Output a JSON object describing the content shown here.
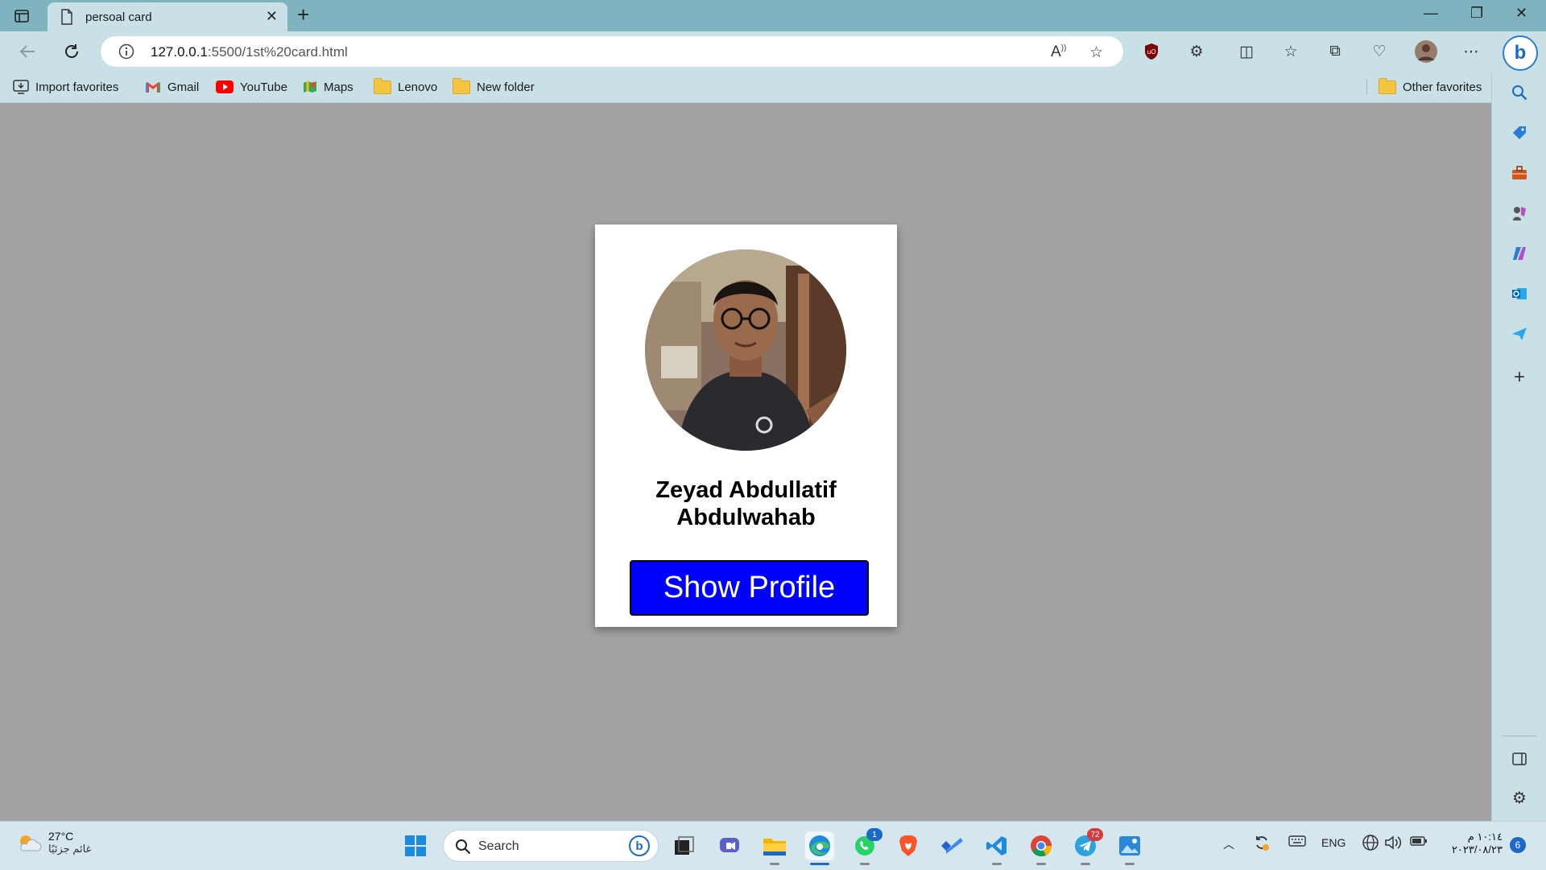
{
  "tab": {
    "title": "persoal card"
  },
  "address": {
    "host": "127.0.0.1",
    "path": ":5500/1st%20card.html"
  },
  "favorites": {
    "items": [
      {
        "label": "Import favorites",
        "icon": "import-icon"
      },
      {
        "label": "Gmail",
        "icon": "gmail-icon"
      },
      {
        "label": "YouTube",
        "icon": "youtube-icon"
      },
      {
        "label": "Maps",
        "icon": "maps-icon"
      },
      {
        "label": "Lenovo",
        "icon": "folder-icon"
      },
      {
        "label": "New folder",
        "icon": "folder-icon"
      }
    ],
    "other": "Other favorites"
  },
  "card": {
    "name_line1": "Zeyad Abdullatif",
    "name_line2": "Abdulwahab",
    "button_label": "Show Profile",
    "button_color": "#0000ff"
  },
  "taskbar": {
    "weather_temp": "27°C",
    "weather_desc": "غائم جزئيًا",
    "search_placeholder": "Search",
    "language": "ENG",
    "time": "١٠:١٤ م",
    "date": "٢٠٢٣/٠٨/٢٣",
    "notifications": "6",
    "whatsapp_badge": "1",
    "telegram_badge": "72"
  },
  "colors": {
    "titlebar": "#7fb3bf",
    "toolbar": "#c8e0e6",
    "page_background": "#a3a3a3"
  }
}
